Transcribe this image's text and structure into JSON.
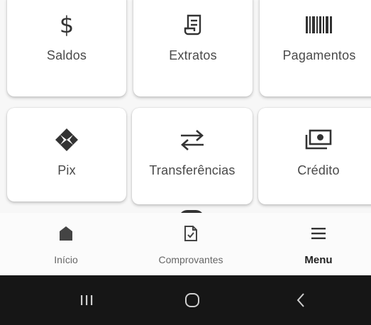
{
  "grid": {
    "items": [
      {
        "label": "Saldos",
        "icon": "dollar-icon"
      },
      {
        "label": "Extratos",
        "icon": "receipt-icon"
      },
      {
        "label": "Pagamentos",
        "icon": "barcode-icon"
      },
      {
        "label": "Pix",
        "icon": "pix-icon"
      },
      {
        "label": "Transferências",
        "icon": "transfer-arrows-icon"
      },
      {
        "label": "Crédito",
        "icon": "money-bill-icon"
      }
    ]
  },
  "nav": {
    "items": [
      {
        "label": "Início",
        "icon": "home-icon",
        "active": false
      },
      {
        "label": "Comprovantes",
        "icon": "document-check-icon",
        "active": false
      },
      {
        "label": "Menu",
        "icon": "hamburger-icon",
        "active": true
      }
    ]
  },
  "system_nav": {
    "buttons": [
      "recent-apps-icon",
      "home-circle-icon",
      "back-chevron-icon"
    ]
  },
  "colors": {
    "background": "#f7f7f7",
    "card": "#ffffff",
    "icon": "#333333",
    "system_bar": "#161616"
  }
}
